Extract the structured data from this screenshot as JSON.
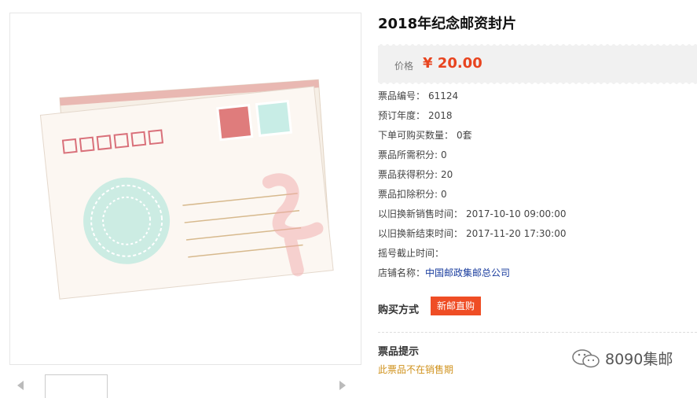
{
  "product": {
    "title": "2018年纪念邮资封片",
    "price_label": "价格",
    "price": "¥ 20.00",
    "details": [
      {
        "label": "票品编号：",
        "value": "61124"
      },
      {
        "label": "预订年度：",
        "value": "2018"
      },
      {
        "label": "下单可购买数量：",
        "value": "0套"
      },
      {
        "label": "票品所需积分:",
        "value": "0"
      },
      {
        "label": "票品获得积分:",
        "value": "20"
      },
      {
        "label": "票品扣除积分:",
        "value": "0"
      },
      {
        "label": "以旧换新销售时间：",
        "value": "2017-10-10 09:00:00"
      },
      {
        "label": "以旧换新结束时间：",
        "value": "2017-11-20 17:30:00"
      },
      {
        "label": "摇号截止时间：",
        "value": ""
      }
    ],
    "shop_label": "店铺名称：",
    "shop_name": "中国邮政集邮总公司",
    "buy_label": "购买方式",
    "buy_button": "新邮直购",
    "tip_title": "票品提示",
    "tip_text": "此票品不在销售期"
  },
  "watermark": "8090集邮",
  "colors": {
    "accent": "#ef4d25",
    "price": "#e8441f",
    "link": "#1a3d9e",
    "tip": "#d0921c"
  }
}
